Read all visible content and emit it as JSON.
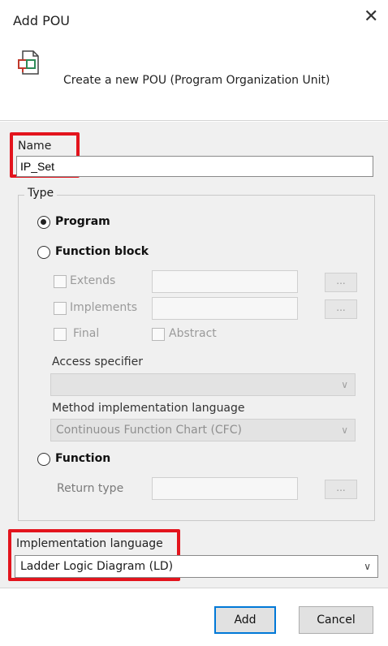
{
  "dialog": {
    "title": "Add POU",
    "subtitle": "Create a new POU (Program Organization Unit)",
    "close_symbol": "✕"
  },
  "name": {
    "label": "Name",
    "value": "IP_Set"
  },
  "type": {
    "legend": "Type",
    "program_label": "Program",
    "function_block_label": "Function block",
    "extends_label": "Extends",
    "implements_label": "Implements",
    "final_label": "Final",
    "abstract_label": "Abstract",
    "dots_label": "...",
    "access_specifier_label": "Access specifier",
    "access_specifier_value": "",
    "method_impl_label": "Method implementation language",
    "method_impl_value": "Continuous Function Chart (CFC)",
    "function_label": "Function",
    "return_type_label": "Return type",
    "selected": "Program"
  },
  "implementation": {
    "label": "Implementation language",
    "value": "Ladder Logic Diagram (LD)"
  },
  "footer": {
    "add_label": "Add",
    "cancel_label": "Cancel"
  },
  "colors": {
    "highlight": "#e3141d",
    "primary_border": "#0078d7",
    "section_bg": "#f0f0f0"
  },
  "icons": {
    "header": "pou-icon",
    "chevron": "chevron-down-icon"
  }
}
